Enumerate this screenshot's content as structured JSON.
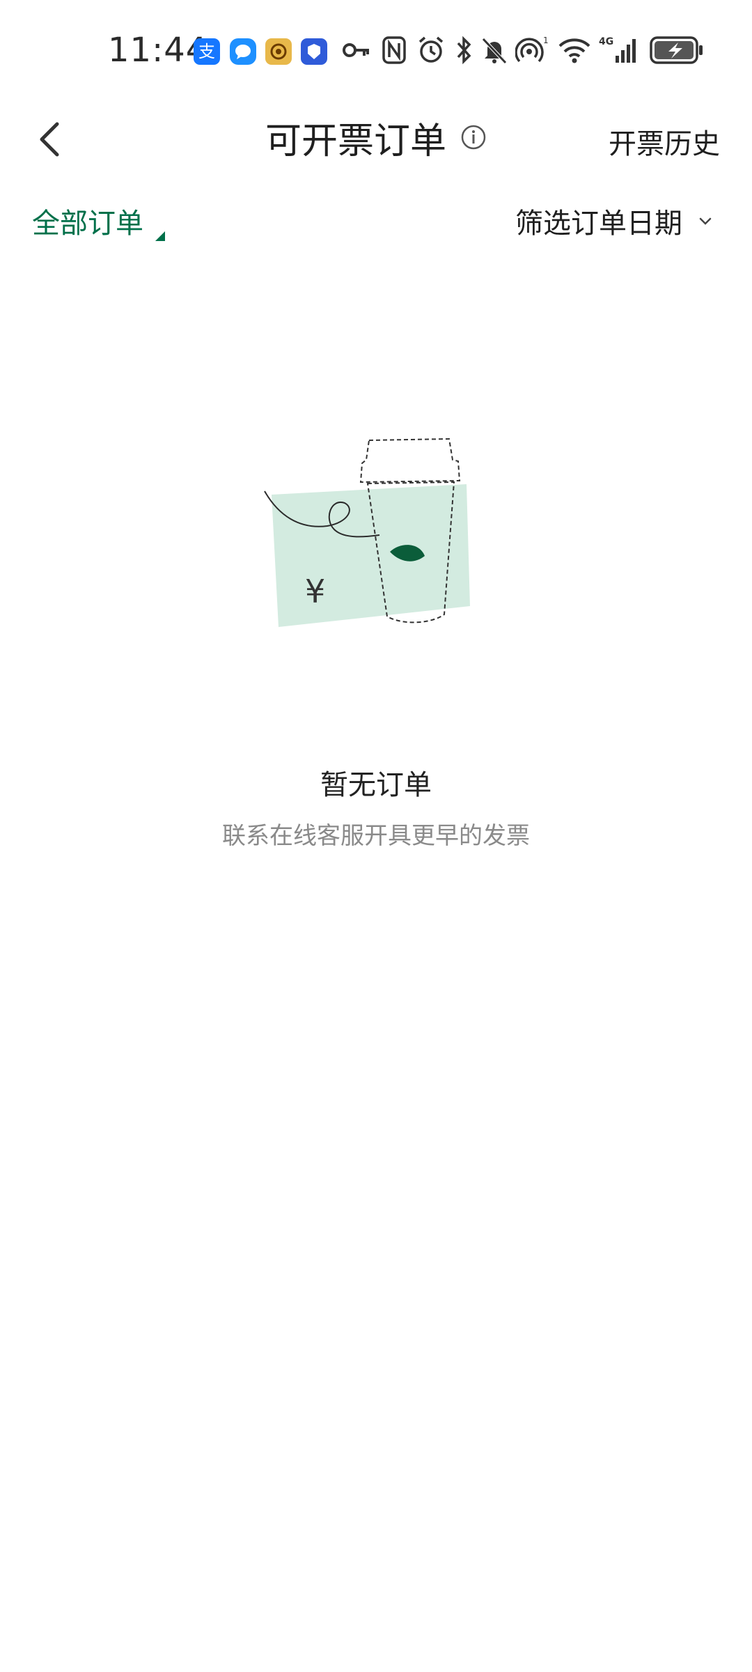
{
  "status_bar": {
    "time": "11:44",
    "signal_badge": "1",
    "network": "4G"
  },
  "header": {
    "title": "可开票订单",
    "history_label": "开票历史"
  },
  "filters": {
    "tab_label": "全部订单",
    "date_filter_label": "筛选订单日期"
  },
  "empty_state": {
    "title": "暂无订单",
    "subtitle": "联系在线客服开具更早的发票",
    "currency_symbol": "¥"
  },
  "colors": {
    "accent": "#00704a",
    "mint": "#d3ebe0",
    "leaf": "#0b5d3a"
  }
}
